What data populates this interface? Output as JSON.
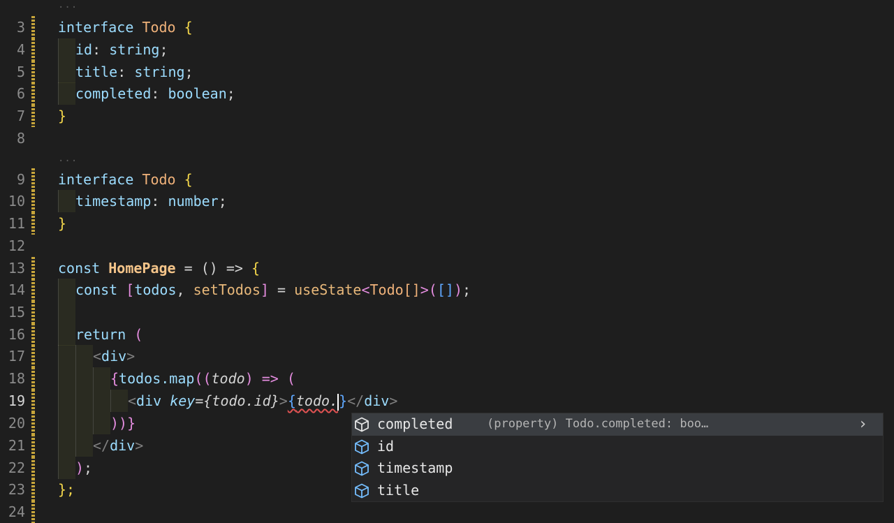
{
  "editor": {
    "fold_marker": "...",
    "lines": [
      {
        "num": "3"
      },
      {
        "num": "4"
      },
      {
        "num": "5"
      },
      {
        "num": "6"
      },
      {
        "num": "7"
      },
      {
        "num": "8"
      },
      {
        "num": "9"
      },
      {
        "num": "10"
      },
      {
        "num": "11"
      },
      {
        "num": "12"
      },
      {
        "num": "13"
      },
      {
        "num": "14"
      },
      {
        "num": "15"
      },
      {
        "num": "16"
      },
      {
        "num": "17"
      },
      {
        "num": "18"
      },
      {
        "num": "19"
      },
      {
        "num": "20"
      },
      {
        "num": "21"
      },
      {
        "num": "22"
      },
      {
        "num": "23"
      },
      {
        "num": "24"
      }
    ],
    "tokens": {
      "interface": "interface",
      "todo_type": "Todo",
      "open_brace": "{",
      "close_brace": "}",
      "id": "id",
      "title": "title",
      "completed": "completed",
      "timestamp": "timestamp",
      "string": "string",
      "boolean": "boolean",
      "number": "number",
      "colon": ":",
      "semi": ";",
      "const": "const",
      "homepage": "HomePage",
      "arrow_decl": " = () => ",
      "destructure_open": "[",
      "todos": "todos",
      "comma": ", ",
      "set_todos": "setTodos",
      "destructure_close": "]",
      "equals": " = ",
      "use_state": "useState",
      "generic_open": "<",
      "todo_arr": "Todo[]",
      "generic_close": ">",
      "call_open": "(",
      "empty_arr": "[]",
      "call_close": ")",
      "return": "return",
      "paren_open": "(",
      "tag_open_div": "<",
      "div": "div",
      "tag_close": ">",
      "map_open": "{",
      "todos_map": "todos.map",
      "map_args": "((",
      "todo_param": "todo",
      "map_arrow": ") => (",
      "key_attr": "key",
      "eq": "=",
      "key_value": "{todo.id}",
      "expr_open": "{",
      "todo_dot": "todo.",
      "expr_close": "}",
      "close_div_open": "</",
      "map_close": "))}",
      "return_close": ")",
      "fn_close": "};"
    }
  },
  "suggest": {
    "items": [
      {
        "label": "completed",
        "detail": "(property) Todo.completed: boo…",
        "icon": "property-cube-icon",
        "selected": true
      },
      {
        "label": "id",
        "detail": "",
        "icon": "property-cube-icon"
      },
      {
        "label": "timestamp",
        "detail": "",
        "icon": "property-cube-icon"
      },
      {
        "label": "title",
        "detail": "",
        "icon": "property-cube-icon"
      }
    ],
    "chevron": "›"
  },
  "colors": {
    "background": "#1e1e1e",
    "diff_bar": "#c7a53b",
    "error_squiggle": "#e05252",
    "suggest_bg": "#252526",
    "suggest_selected": "#3a3d41"
  }
}
